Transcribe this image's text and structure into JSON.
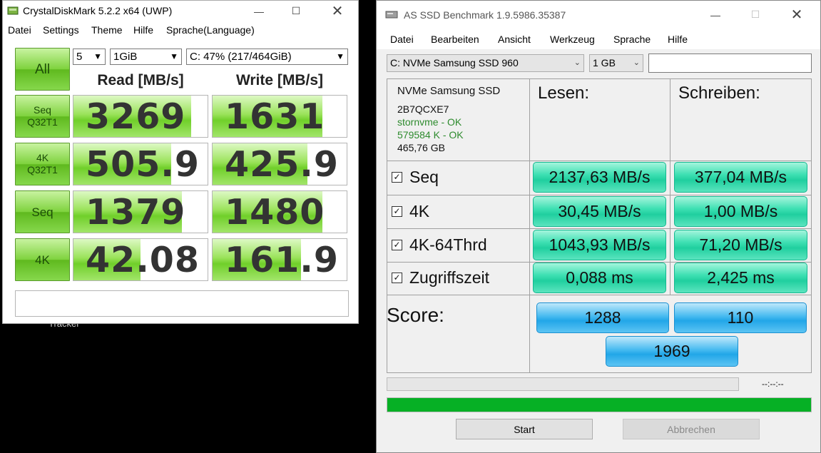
{
  "desktop": {
    "label": "Tracker"
  },
  "cdm": {
    "title": "CrystalDiskMark 5.2.2 x64 (UWP)",
    "menu": [
      "Datei",
      "Settings",
      "Theme",
      "Hilfe",
      "Sprache(Language)"
    ],
    "all_label": "All",
    "count_select": "5",
    "size_select": "1GiB",
    "drive_select": "C: 47% (217/464GiB)",
    "read_header": "Read [MB/s]",
    "write_header": "Write [MB/s]",
    "rows": [
      {
        "label1": "Seq",
        "label2": "Q32T1",
        "read": "3269",
        "write": "1631",
        "read_fill": 0.88,
        "write_fill": 0.82
      },
      {
        "label1": "4K",
        "label2": "Q32T1",
        "read": "505.9",
        "write": "425.9",
        "read_fill": 0.73,
        "write_fill": 0.71
      },
      {
        "label1": "Seq",
        "label2": "",
        "read": "1379",
        "write": "1480",
        "read_fill": 0.81,
        "write_fill": 0.82
      },
      {
        "label1": "4K",
        "label2": "",
        "read": "42.08",
        "write": "161.9",
        "read_fill": 0.5,
        "write_fill": 0.66
      }
    ],
    "comment": "",
    "colors": {
      "accent": "#7ed23d"
    },
    "icons": {
      "app": "disk-icon",
      "minimize": "minimize-icon",
      "maximize": "maximize-icon",
      "close": "close-icon"
    }
  },
  "asssd": {
    "title": "AS SSD Benchmark 1.9.5986.35387",
    "menu": [
      "Datei",
      "Bearbeiten",
      "Ansicht",
      "Werkzeug",
      "Sprache",
      "Hilfe"
    ],
    "drive_select": "C: NVMe Samsung SSD 960",
    "size_select": "1 GB",
    "search_value": "",
    "info": {
      "model": "NVMe Samsung SSD",
      "firmware": "2B7QCXE7",
      "driver": "stornvme - OK",
      "alignment": "579584 K - OK",
      "capacity": "465,76 GB"
    },
    "read_header": "Lesen:",
    "write_header": "Schreiben:",
    "rows": [
      {
        "label": "Seq",
        "read": "2137,63 MB/s",
        "write": "377,04 MB/s"
      },
      {
        "label": "4K",
        "read": "30,45 MB/s",
        "write": "1,00 MB/s"
      },
      {
        "label": "4K-64Thrd",
        "read": "1043,93 MB/s",
        "write": "71,20 MB/s"
      },
      {
        "label": "Zugriffszeit",
        "read": "0,088 ms",
        "write": "2,425 ms"
      }
    ],
    "score_label": "Score:",
    "score_read": "1288",
    "score_write": "110",
    "score_total": "1969",
    "timer": "--:--:--",
    "progress_top": 0,
    "progress_bottom": 1.0,
    "start_label": "Start",
    "abort_label": "Abbrechen",
    "colors": {
      "ok_text": "#2e8b2e",
      "teal": "#20cf9f",
      "blue": "#22a6e8",
      "progress": "#06b025"
    },
    "icons": {
      "app": "disk-icon",
      "checkbox": "checkbox-checked-icon"
    }
  }
}
